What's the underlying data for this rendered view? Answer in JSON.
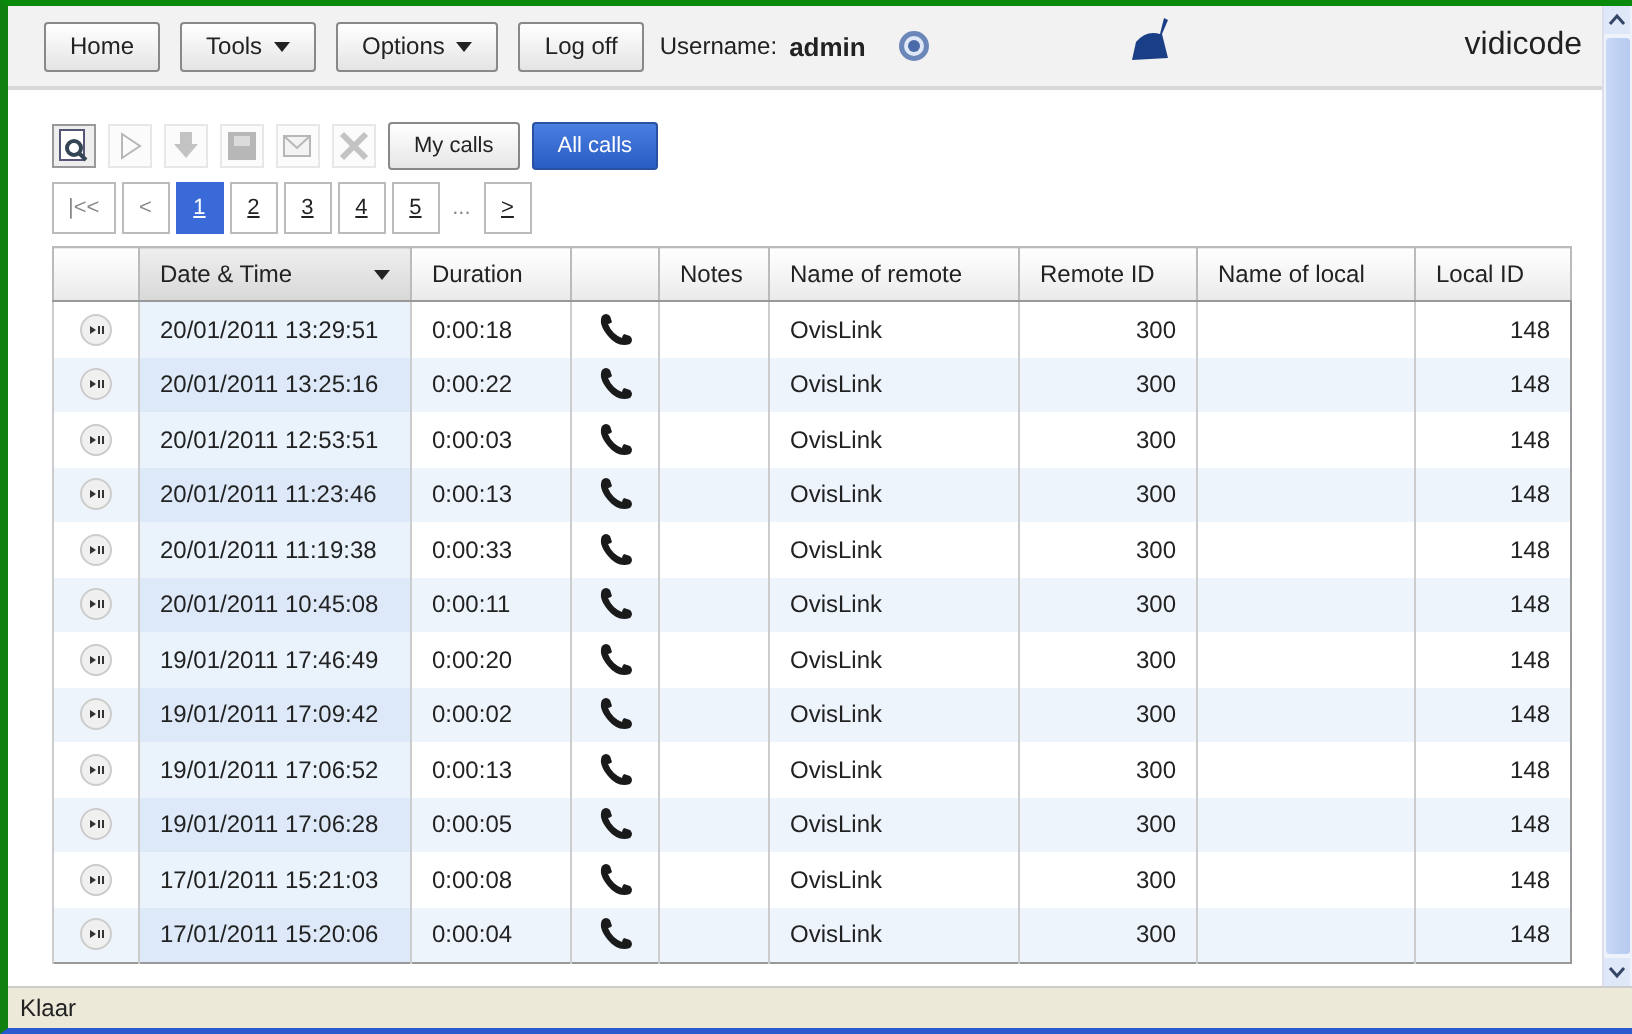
{
  "top_bar": {
    "buttons": [
      {
        "label": "Home",
        "dropdown": false
      },
      {
        "label": "Tools",
        "dropdown": true
      },
      {
        "label": "Options",
        "dropdown": true
      },
      {
        "label": "Log off",
        "dropdown": false
      }
    ],
    "username_label": "Username:",
    "username": "admin",
    "brand": "vidicode"
  },
  "toolbar": [
    {
      "kind": "preview",
      "disabled": false
    },
    {
      "kind": "play",
      "disabled": true
    },
    {
      "kind": "download",
      "disabled": true
    },
    {
      "kind": "save",
      "disabled": true
    },
    {
      "kind": "mail",
      "disabled": true
    },
    {
      "kind": "delete",
      "disabled": true
    }
  ],
  "filters": [
    {
      "label": "My calls",
      "selected": false
    },
    {
      "label": "All calls",
      "selected": true
    }
  ],
  "pager": [
    {
      "label": "|<<",
      "selected": false
    },
    {
      "label": "<",
      "selected": false
    },
    {
      "label": "1",
      "selected": true
    },
    {
      "label": "2",
      "selected": false
    },
    {
      "label": "3",
      "selected": false
    },
    {
      "label": "4",
      "selected": false
    },
    {
      "label": "5",
      "selected": false
    },
    {
      "label": "...",
      "selected": false
    },
    {
      "label": ">",
      "selected": false
    }
  ],
  "table": {
    "columns": [
      "",
      "Date & Time",
      "Duration",
      "",
      "Notes",
      "Name of remote",
      "Remote ID",
      "Name of local",
      "Local ID"
    ],
    "rows": [
      {
        "date": "20/01/2011 13:29:51",
        "duration": "0:00:18",
        "notes": "",
        "remote": "OvisLink",
        "remote_id": "300",
        "local": "",
        "local_id": "148"
      },
      {
        "date": "20/01/2011 13:25:16",
        "duration": "0:00:22",
        "notes": "",
        "remote": "OvisLink",
        "remote_id": "300",
        "local": "",
        "local_id": "148"
      },
      {
        "date": "20/01/2011 12:53:51",
        "duration": "0:00:03",
        "notes": "",
        "remote": "OvisLink",
        "remote_id": "300",
        "local": "",
        "local_id": "148"
      },
      {
        "date": "20/01/2011 11:23:46",
        "duration": "0:00:13",
        "notes": "",
        "remote": "OvisLink",
        "remote_id": "300",
        "local": "",
        "local_id": "148"
      },
      {
        "date": "20/01/2011 11:19:38",
        "duration": "0:00:33",
        "notes": "",
        "remote": "OvisLink",
        "remote_id": "300",
        "local": "",
        "local_id": "148"
      },
      {
        "date": "20/01/2011 10:45:08",
        "duration": "0:00:11",
        "notes": "",
        "remote": "OvisLink",
        "remote_id": "300",
        "local": "",
        "local_id": "148"
      },
      {
        "date": "19/01/2011 17:46:49",
        "duration": "0:00:20",
        "notes": "",
        "remote": "OvisLink",
        "remote_id": "300",
        "local": "",
        "local_id": "148"
      },
      {
        "date": "19/01/2011 17:09:42",
        "duration": "0:00:02",
        "notes": "",
        "remote": "OvisLink",
        "remote_id": "300",
        "local": "",
        "local_id": "148"
      },
      {
        "date": "19/01/2011 17:06:52",
        "duration": "0:00:13",
        "notes": "",
        "remote": "OvisLink",
        "remote_id": "300",
        "local": "",
        "local_id": "148"
      },
      {
        "date": "19/01/2011 17:06:28",
        "duration": "0:00:05",
        "notes": "",
        "remote": "OvisLink",
        "remote_id": "300",
        "local": "",
        "local_id": "148"
      },
      {
        "date": "17/01/2011 15:21:03",
        "duration": "0:00:08",
        "notes": "",
        "remote": "OvisLink",
        "remote_id": "300",
        "local": "",
        "local_id": "148"
      },
      {
        "date": "17/01/2011 15:20:06",
        "duration": "0:00:04",
        "notes": "",
        "remote": "OvisLink",
        "remote_id": "300",
        "local": "",
        "local_id": "148"
      }
    ]
  },
  "status_bar": "Klaar"
}
